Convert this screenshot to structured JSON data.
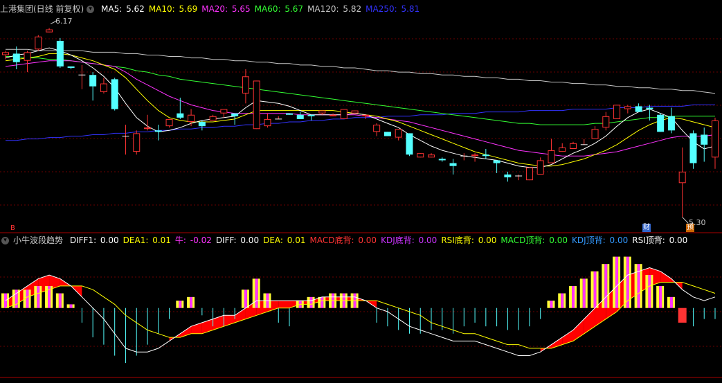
{
  "header": {
    "title": "上港集团(日线 前复权)",
    "ma": [
      {
        "label": "MA5:",
        "value": "5.62",
        "color": "#ffffff"
      },
      {
        "label": "MA10:",
        "value": "5.69",
        "color": "#ffff00"
      },
      {
        "label": "MA20:",
        "value": "5.65",
        "color": "#ff33ff"
      },
      {
        "label": "MA60:",
        "value": "5.67",
        "color": "#33ff33"
      },
      {
        "label": "MA120:",
        "value": "5.82",
        "color": "#c8c8c8"
      },
      {
        "label": "MA250:",
        "value": "5.81",
        "color": "#3333ff"
      }
    ]
  },
  "price_annotations": {
    "high_label": "6.17",
    "low_label": "5.30",
    "bottom_left_mark": "B",
    "badge_cai": "财",
    "badge_yu": "预"
  },
  "indicator": {
    "title": "小牛波段趋势",
    "fields": [
      {
        "label": "DIFF1:",
        "value": "0.00",
        "color": "#ffffff"
      },
      {
        "label": "DEA1:",
        "value": "0.01",
        "color": "#ffff00"
      },
      {
        "label": "牛:",
        "value": "-0.02",
        "color": "#ff33ff"
      },
      {
        "label": "DIFF:",
        "value": "0.00",
        "color": "#ffffff"
      },
      {
        "label": "DEA:",
        "value": "0.01",
        "color": "#ffff00"
      },
      {
        "label": "MACD底背:",
        "value": "0.00",
        "color": "#ff3333"
      },
      {
        "label": "KDJ底背:",
        "value": "0.00",
        "color": "#cc33ff"
      },
      {
        "label": "RSI底背:",
        "value": "0.00",
        "color": "#ffff00"
      },
      {
        "label": "MACD顶背:",
        "value": "0.00",
        "color": "#33ff33"
      },
      {
        "label": "KDJ顶背:",
        "value": "0.00",
        "color": "#3399ff"
      },
      {
        "label": "RSI顶背:",
        "value": "0.00",
        "color": "#ffffff"
      }
    ]
  },
  "colors": {
    "up": "#ff3333",
    "down": "#54ffff",
    "grid": "#6b0000",
    "ma5": "#ffffff",
    "ma10": "#ffff00",
    "ma20": "#ff33ff",
    "ma60": "#33ff33",
    "ma120": "#c8c8c8",
    "ma250": "#3333ff"
  },
  "chart_data": {
    "type": "candlestick",
    "candles": [
      [
        5.97,
        5.99,
        5.94,
        6.0
      ],
      [
        5.98,
        5.92,
        5.87,
        6.03
      ],
      [
        5.93,
        5.99,
        5.85,
        6.0
      ],
      [
        6.01,
        6.1,
        6.0,
        6.11
      ],
      [
        6.13,
        6.15,
        6.13,
        6.16
      ],
      [
        6.07,
        5.89,
        5.88,
        6.09
      ],
      [
        5.89,
        5.88,
        5.87,
        5.89
      ],
      [
        5.83,
        5.83,
        5.73,
        5.9
      ],
      [
        5.83,
        5.75,
        5.65,
        5.85
      ],
      [
        5.71,
        5.77,
        5.7,
        5.81
      ],
      [
        5.8,
        5.59,
        5.58,
        5.81
      ],
      [
        5.4,
        5.4,
        5.27,
        5.48
      ],
      [
        5.29,
        5.42,
        5.27,
        5.44
      ],
      [
        5.45,
        5.46,
        5.44,
        5.55
      ],
      [
        5.44,
        5.43,
        5.37,
        5.48
      ],
      [
        5.47,
        5.52,
        5.46,
        5.5
      ],
      [
        5.56,
        5.53,
        5.52,
        5.67
      ],
      [
        5.5,
        5.55,
        5.47,
        5.59
      ],
      [
        5.5,
        5.47,
        5.44,
        5.51
      ],
      [
        5.51,
        5.54,
        5.52,
        5.55
      ],
      [
        5.56,
        5.59,
        5.53,
        5.55
      ],
      [
        5.56,
        5.54,
        5.48,
        5.54
      ],
      [
        5.7,
        5.82,
        5.63,
        5.87
      ],
      [
        5.45,
        5.79,
        5.45,
        5.79
      ],
      [
        5.47,
        5.52,
        5.46,
        5.56
      ],
      [
        5.52,
        5.52,
        5.55,
        5.54
      ],
      [
        5.56,
        5.55,
        5.56,
        5.51
      ],
      [
        5.55,
        5.52,
        5.53,
        5.57
      ],
      [
        5.55,
        5.54,
        5.51,
        5.55
      ],
      [
        5.56,
        5.58,
        5.55,
        5.57
      ],
      [
        5.54,
        5.55,
        5.54,
        5.56
      ],
      [
        5.52,
        5.59,
        5.53,
        5.52
      ],
      [
        5.56,
        5.58,
        5.56,
        5.55
      ],
      [
        5.54,
        5.55,
        5.52,
        5.47
      ],
      [
        5.43,
        5.48,
        5.4,
        5.49
      ],
      [
        5.43,
        5.4,
        5.4,
        5.41
      ],
      [
        5.39,
        5.45,
        5.37,
        5.42
      ],
      [
        5.42,
        5.27,
        5.26,
        5.42
      ],
      [
        5.25,
        5.28,
        5.27,
        5.28
      ],
      [
        5.25,
        5.27,
        5.25,
        5.28
      ],
      [
        5.24,
        5.23,
        5.22,
        5.25
      ],
      [
        5.21,
        5.19,
        5.13,
        5.24
      ],
      [
        5.26,
        5.26,
        5.23,
        5.28
      ],
      [
        5.26,
        5.27,
        5.22,
        5.28
      ],
      [
        5.27,
        5.26,
        5.24,
        5.31
      ],
      [
        5.23,
        5.21,
        5.14,
        5.23
      ],
      [
        5.13,
        5.11,
        5.08,
        5.15
      ],
      [
        5.12,
        5.12,
        5.09,
        5.13
      ],
      [
        5.09,
        5.18,
        5.11,
        5.17
      ],
      [
        5.13,
        5.23,
        5.23,
        5.25
      ],
      [
        5.21,
        5.3,
        5.21,
        5.38
      ],
      [
        5.29,
        5.32,
        5.3,
        5.35
      ],
      [
        5.31,
        5.35,
        5.33,
        5.36
      ],
      [
        5.34,
        5.34,
        5.35,
        5.38
      ],
      [
        5.38,
        5.45,
        5.39,
        5.47
      ],
      [
        5.46,
        5.54,
        5.44,
        5.57
      ],
      [
        5.52,
        5.62,
        5.55,
        5.62
      ],
      [
        5.59,
        5.61,
        5.56,
        5.62
      ],
      [
        5.61,
        5.57,
        5.58,
        5.63
      ],
      [
        5.6,
        5.59,
        5.51,
        5.62
      ],
      [
        5.55,
        5.43,
        5.43,
        5.56
      ],
      [
        5.54,
        5.44,
        5.42,
        5.6
      ],
      [
        5.07,
        5.15,
        4.83,
        5.32
      ],
      [
        5.42,
        5.21,
        5.17,
        5.44
      ],
      [
        5.41,
        5.34,
        5.22,
        5.46
      ],
      [
        5.25,
        5.51,
        5.17,
        5.53
      ]
    ],
    "candle_fields": [
      "open",
      "close",
      "low",
      "high"
    ],
    "ma": {
      "ma5": [
        5.95,
        5.97,
        5.98,
        6.0,
        6.02,
        6.0,
        5.97,
        5.93,
        5.88,
        5.82,
        5.74,
        5.63,
        5.53,
        5.47,
        5.43,
        5.44,
        5.46,
        5.49,
        5.51,
        5.52,
        5.53,
        5.54,
        5.6,
        5.65,
        5.64,
        5.63,
        5.61,
        5.58,
        5.55,
        5.55,
        5.55,
        5.55,
        5.56,
        5.55,
        5.52,
        5.49,
        5.46,
        5.41,
        5.37,
        5.33,
        5.3,
        5.28,
        5.26,
        5.25,
        5.24,
        5.23,
        5.21,
        5.19,
        5.18,
        5.18,
        5.2,
        5.24,
        5.28,
        5.31,
        5.35,
        5.4,
        5.47,
        5.53,
        5.57,
        5.59,
        5.56,
        5.53,
        5.44,
        5.36,
        5.31,
        5.33
      ],
      "ma10": [
        5.93,
        5.94,
        5.95,
        5.96,
        5.98,
        5.98,
        5.97,
        5.95,
        5.93,
        5.9,
        5.87,
        5.81,
        5.73,
        5.65,
        5.58,
        5.53,
        5.51,
        5.5,
        5.5,
        5.5,
        5.51,
        5.52,
        5.55,
        5.58,
        5.58,
        5.58,
        5.58,
        5.58,
        5.58,
        5.58,
        5.58,
        5.57,
        5.56,
        5.55,
        5.54,
        5.52,
        5.5,
        5.47,
        5.44,
        5.41,
        5.38,
        5.35,
        5.32,
        5.29,
        5.27,
        5.25,
        5.23,
        5.21,
        5.2,
        5.19,
        5.19,
        5.2,
        5.22,
        5.24,
        5.27,
        5.3,
        5.34,
        5.39,
        5.44,
        5.48,
        5.51,
        5.53,
        5.52,
        5.5,
        5.48,
        5.46
      ],
      "ma20": [
        5.89,
        5.9,
        5.91,
        5.92,
        5.93,
        5.93,
        5.93,
        5.92,
        5.91,
        5.9,
        5.89,
        5.85,
        5.8,
        5.76,
        5.72,
        5.68,
        5.65,
        5.62,
        5.6,
        5.58,
        5.57,
        5.56,
        5.56,
        5.56,
        5.56,
        5.56,
        5.56,
        5.55,
        5.55,
        5.55,
        5.55,
        5.55,
        5.55,
        5.54,
        5.53,
        5.52,
        5.51,
        5.5,
        5.48,
        5.46,
        5.44,
        5.42,
        5.4,
        5.38,
        5.36,
        5.34,
        5.32,
        5.3,
        5.29,
        5.28,
        5.27,
        5.26,
        5.26,
        5.26,
        5.27,
        5.28,
        5.29,
        5.31,
        5.33,
        5.35,
        5.37,
        5.39,
        5.4,
        5.4,
        5.4,
        5.41
      ],
      "ma60": [
        5.96,
        5.96,
        5.95,
        5.95,
        5.94,
        5.94,
        5.93,
        5.92,
        5.91,
        5.9,
        5.89,
        5.88,
        5.86,
        5.85,
        5.83,
        5.82,
        5.8,
        5.79,
        5.78,
        5.77,
        5.76,
        5.75,
        5.74,
        5.73,
        5.72,
        5.71,
        5.7,
        5.69,
        5.68,
        5.67,
        5.66,
        5.65,
        5.64,
        5.63,
        5.62,
        5.61,
        5.6,
        5.59,
        5.58,
        5.57,
        5.56,
        5.55,
        5.54,
        5.53,
        5.52,
        5.51,
        5.5,
        5.49,
        5.49,
        5.48,
        5.48,
        5.48,
        5.48,
        5.48,
        5.49,
        5.49,
        5.5,
        5.51,
        5.52,
        5.53,
        5.53,
        5.54,
        5.54,
        5.54,
        5.54,
        5.54
      ],
      "ma120": [
        6.01,
        6.01,
        6.01,
        6.0,
        6.0,
        6.0,
        6.0,
        6.0,
        5.99,
        5.99,
        5.99,
        5.98,
        5.98,
        5.97,
        5.97,
        5.96,
        5.96,
        5.95,
        5.95,
        5.94,
        5.94,
        5.93,
        5.93,
        5.92,
        5.92,
        5.91,
        5.91,
        5.9,
        5.9,
        5.89,
        5.89,
        5.88,
        5.88,
        5.87,
        5.86,
        5.86,
        5.85,
        5.85,
        5.84,
        5.84,
        5.83,
        5.83,
        5.82,
        5.82,
        5.81,
        5.81,
        5.8,
        5.8,
        5.79,
        5.79,
        5.78,
        5.78,
        5.77,
        5.77,
        5.76,
        5.76,
        5.75,
        5.75,
        5.74,
        5.74,
        5.73,
        5.73,
        5.72,
        5.72,
        5.71,
        5.7
      ],
      "ma250": [
        5.37,
        5.37,
        5.38,
        5.38,
        5.39,
        5.39,
        5.4,
        5.4,
        5.41,
        5.41,
        5.42,
        5.42,
        5.43,
        5.43,
        5.44,
        5.44,
        5.45,
        5.45,
        5.46,
        5.46,
        5.47,
        5.47,
        5.48,
        5.48,
        5.49,
        5.49,
        5.5,
        5.5,
        5.51,
        5.51,
        5.52,
        5.52,
        5.53,
        5.53,
        5.53,
        5.54,
        5.54,
        5.54,
        5.55,
        5.55,
        5.55,
        5.56,
        5.56,
        5.56,
        5.57,
        5.57,
        5.57,
        5.57,
        5.58,
        5.58,
        5.58,
        5.58,
        5.59,
        5.59,
        5.59,
        5.59,
        5.6,
        5.6,
        5.6,
        5.61,
        5.61,
        5.61,
        5.61,
        5.62,
        5.62,
        5.62
      ]
    },
    "price_range": [
      4.75,
      6.25
    ],
    "macd": {
      "range": [
        -0.18,
        0.16
      ],
      "diff": [
        0.02,
        0.04,
        0.06,
        0.08,
        0.09,
        0.08,
        0.06,
        0.03,
        0.0,
        -0.03,
        -0.07,
        -0.11,
        -0.12,
        -0.12,
        -0.11,
        -0.09,
        -0.07,
        -0.05,
        -0.04,
        -0.03,
        -0.02,
        -0.02,
        0.0,
        0.02,
        0.02,
        0.02,
        0.02,
        0.02,
        0.02,
        0.03,
        0.03,
        0.03,
        0.03,
        0.02,
        0.0,
        -0.01,
        -0.03,
        -0.05,
        -0.06,
        -0.07,
        -0.08,
        -0.09,
        -0.09,
        -0.09,
        -0.1,
        -0.11,
        -0.12,
        -0.13,
        -0.13,
        -0.12,
        -0.1,
        -0.08,
        -0.06,
        -0.03,
        0.0,
        0.03,
        0.06,
        0.09,
        0.1,
        0.11,
        0.1,
        0.08,
        0.05,
        0.03,
        0.02,
        0.03
      ],
      "dea": [
        0.0,
        0.01,
        0.03,
        0.04,
        0.05,
        0.06,
        0.06,
        0.06,
        0.05,
        0.03,
        0.01,
        -0.02,
        -0.04,
        -0.06,
        -0.07,
        -0.08,
        -0.08,
        -0.07,
        -0.07,
        -0.06,
        -0.05,
        -0.04,
        -0.03,
        -0.02,
        -0.01,
        0.0,
        0.0,
        0.01,
        0.01,
        0.02,
        0.02,
        0.02,
        0.02,
        0.02,
        0.02,
        0.01,
        0.0,
        -0.01,
        -0.02,
        -0.04,
        -0.05,
        -0.06,
        -0.07,
        -0.07,
        -0.08,
        -0.09,
        -0.1,
        -0.1,
        -0.11,
        -0.11,
        -0.11,
        -0.1,
        -0.09,
        -0.07,
        -0.05,
        -0.03,
        -0.01,
        0.02,
        0.04,
        0.06,
        0.07,
        0.07,
        0.07,
        0.06,
        0.05,
        0.04
      ],
      "hist": [
        0.04,
        0.05,
        0.05,
        0.06,
        0.06,
        0.04,
        0.01,
        -0.04,
        -0.08,
        -0.1,
        -0.13,
        -0.15,
        -0.13,
        -0.1,
        -0.07,
        -0.03,
        0.02,
        0.03,
        -0.02,
        -0.05,
        -0.05,
        -0.03,
        0.05,
        0.08,
        0.04,
        -0.04,
        -0.05,
        0.02,
        0.03,
        0.03,
        0.04,
        0.04,
        0.04,
        0.0,
        -0.04,
        -0.05,
        -0.06,
        -0.07,
        -0.07,
        -0.06,
        -0.06,
        -0.07,
        -0.05,
        -0.04,
        -0.05,
        -0.05,
        -0.06,
        -0.06,
        -0.05,
        -0.03,
        0.02,
        0.04,
        0.06,
        0.08,
        0.1,
        0.12,
        0.14,
        0.14,
        0.12,
        0.09,
        0.06,
        0.03,
        -0.04,
        -0.05,
        -0.03,
        -0.03
      ]
    }
  }
}
